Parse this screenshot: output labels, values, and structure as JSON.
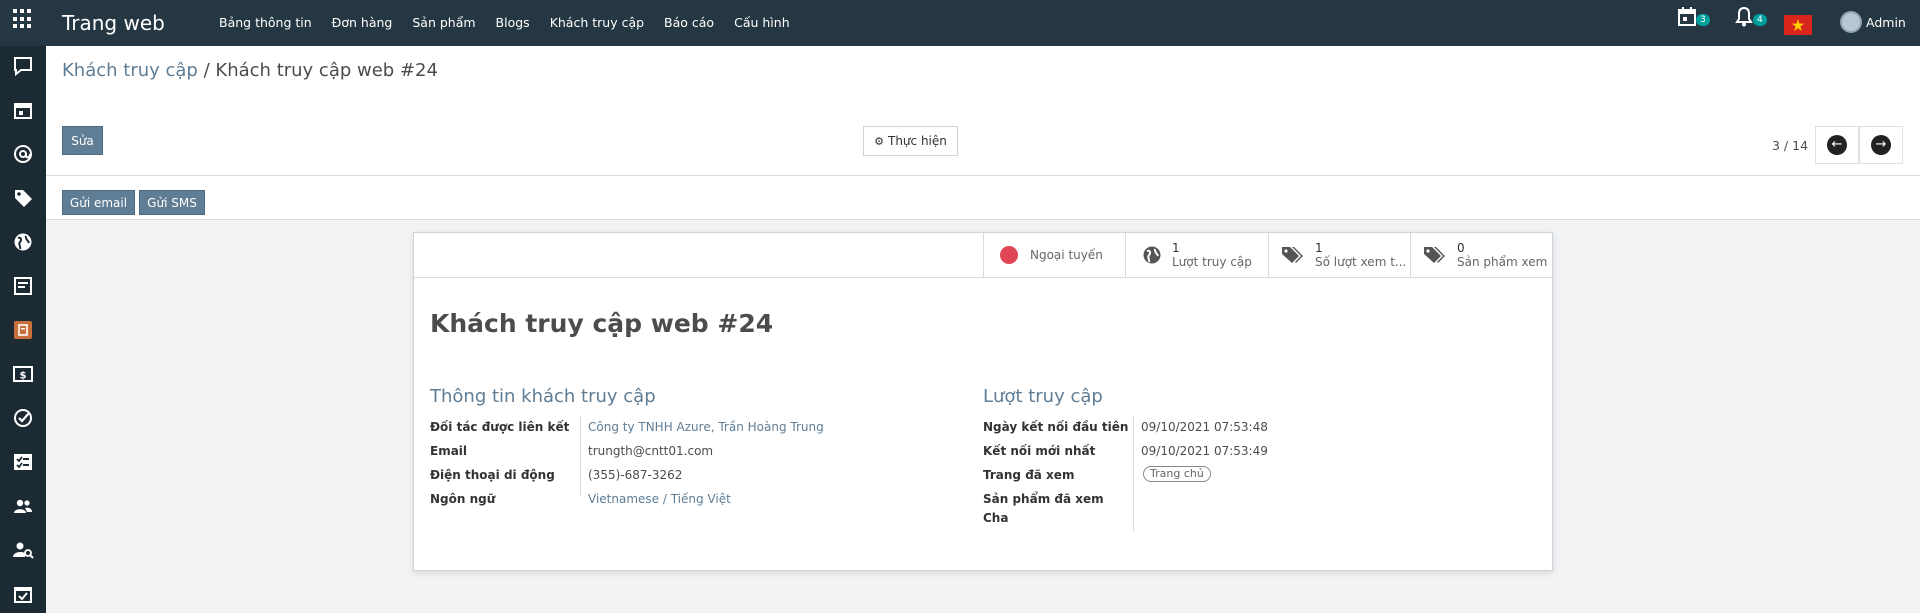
{
  "navbar": {
    "brand": "Trang web",
    "menu": [
      "Bảng thông tin",
      "Đơn hàng",
      "Sản phẩm",
      "Blogs",
      "Khách truy cập",
      "Báo cáo",
      "Cấu hình"
    ],
    "activities_count": "3",
    "notifications_count": "4",
    "user": "Admin",
    "flag_color": "#da251d"
  },
  "sidebar_icons": [
    "discuss-icon",
    "calendar-icon",
    "contacts-at-icon",
    "tag-icon",
    "website-globe-icon",
    "document-icon",
    "product-box-icon",
    "money-icon",
    "check-circle-icon",
    "checklist-icon",
    "team-icon",
    "user-search-icon",
    "calendar-check-icon"
  ],
  "breadcrumb": {
    "parent": "Khách truy cập",
    "separator": "/",
    "current": "Khách truy cập web #24"
  },
  "toolbar": {
    "edit_label": "Sửa",
    "action_label": "Thực hiện",
    "pager": "3 / 14"
  },
  "header_buttons": {
    "send_email": "Gửi email",
    "send_sms": "Gửi SMS"
  },
  "smart_buttons": {
    "status": "Ngoại tuyến",
    "visits_count": "1",
    "visits_label": "Lượt truy cập",
    "page_views_count": "1",
    "page_views_label": "Số lượt xem t...",
    "products_count": "0",
    "products_label": "Sản phẩm xem"
  },
  "record": {
    "title": "Khách truy cập web #24"
  },
  "visitor_info": {
    "heading": "Thông tin khách truy cập",
    "partner_label": "Đối tác được liên kết",
    "partner_value": "Công ty TNHH Azure, Trần Hoàng Trung",
    "email_label": "Email",
    "email_value": "trungth@cntt01.com",
    "mobile_label": "Điện thoại di động",
    "mobile_value": "(355)-687-3262",
    "lang_label": "Ngôn ngữ",
    "lang_value": "Vietnamese / Tiếng Việt"
  },
  "visits_info": {
    "heading": "Lượt truy cập",
    "first_conn_label": "Ngày kết nối đầu tiên",
    "first_conn_value": "09/10/2021 07:53:48",
    "last_conn_label": "Kết nối mới nhất",
    "last_conn_value": "09/10/2021 07:53:49",
    "pages_label": "Trang đã xem",
    "pages_tag": "Trang chủ",
    "products_label_line1": "Sản phẩm đã xem",
    "products_label_line2": "Cha"
  },
  "colors": {
    "navbar": "#243742",
    "sidebar": "#1c2a33",
    "primary": "#5f7d95",
    "offline_dot": "#e04656"
  }
}
